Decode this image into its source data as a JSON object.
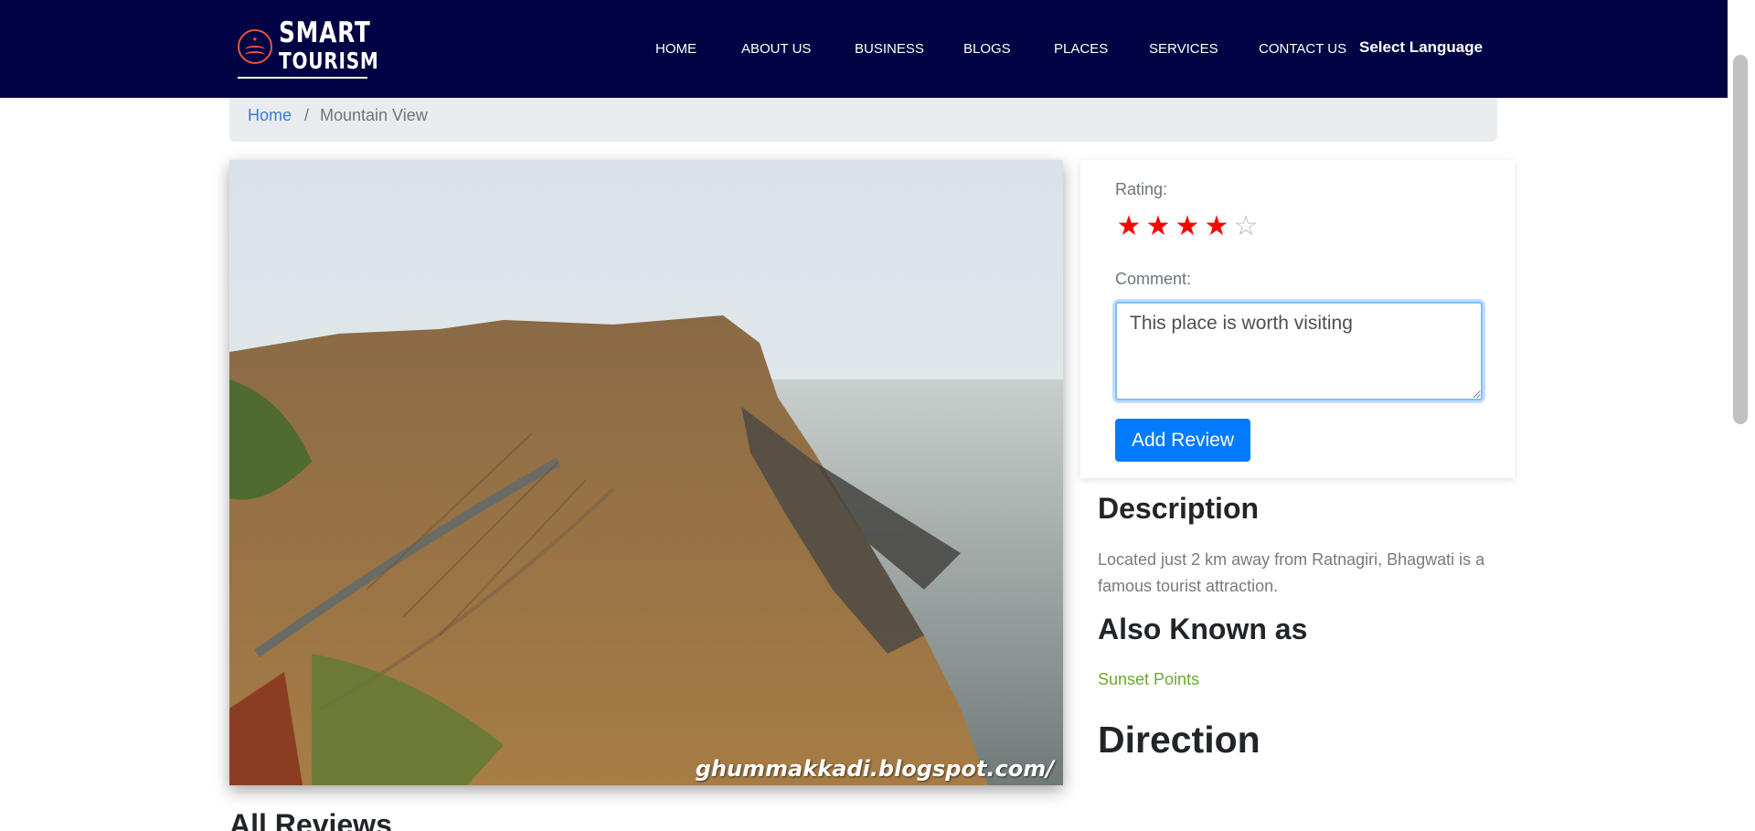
{
  "brand": {
    "line1": "SMART",
    "line2": "TOURISM",
    "accent_color": "#e2563a",
    "navbar_color": "#020344"
  },
  "nav": {
    "items": [
      {
        "label": "HOME"
      },
      {
        "label": "ABOUT US"
      },
      {
        "label": "BUSINESS"
      },
      {
        "label": "BLOGS"
      },
      {
        "label": "PLACES"
      },
      {
        "label": "SERVICES"
      },
      {
        "label": "CONTACT US"
      }
    ],
    "language_label": "Select Language"
  },
  "breadcrumb": {
    "home": "Home",
    "separator": "/",
    "current": "Mountain View"
  },
  "image": {
    "watermark": "ghummakkadi.blogspot.com/"
  },
  "review_form": {
    "rating_label": "Rating:",
    "rating_value": 4,
    "rating_max": 5,
    "star_color": "#ff0000",
    "comment_label": "Comment:",
    "comment_value": "This place is worth visiting ",
    "submit_label": "Add Review",
    "button_color": "#007bff"
  },
  "details": {
    "description_heading": "Description",
    "description_text": "Located just 2 km away from Ratnagiri, Bhagwati is a famous tourist attraction.",
    "aka_heading": "Also Known as",
    "aka_value": "Sunset Points",
    "direction_heading": "Direction"
  },
  "reviews": {
    "heading": "All Reviews"
  }
}
